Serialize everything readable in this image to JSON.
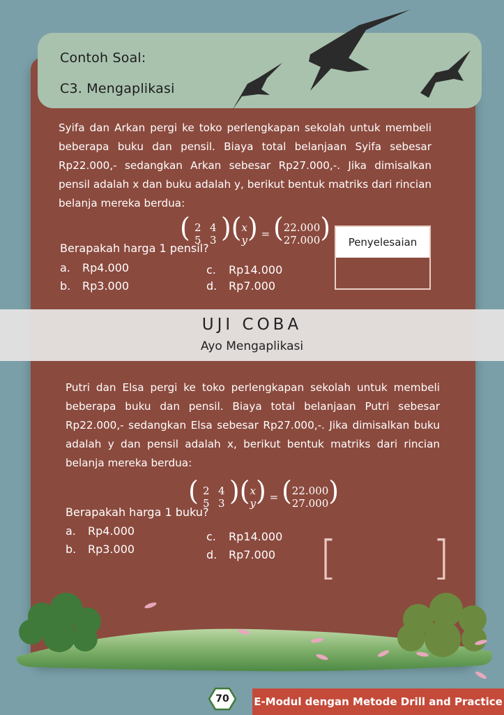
{
  "header": {
    "label": "Contoh Soal:",
    "section": "C3. Mengaplikasi"
  },
  "example": {
    "paragraph": "Syifa dan Arkan pergi ke toko perlengkapan sekolah untuk membeli beberapa buku dan pensil. Biaya total belanjaan Syifa sebesar Rp22.000,- sedangkan Arkan sebesar Rp27.000,-. Jika dimisalkan pensil adalah x dan buku adalah y, berikut bentuk matriks dari rincian belanja mereka berdua:",
    "matrix": {
      "a": "2",
      "b": "4",
      "c": "5",
      "d": "3",
      "v1": "x",
      "v2": "y",
      "r1": "22.000",
      "r2": "27.000",
      "eq": "="
    },
    "question": "Berapakah harga 1 pensil?",
    "options": [
      {
        "letter": "a.",
        "text": "Rp4.000"
      },
      {
        "letter": "b.",
        "text": "Rp3.000"
      },
      {
        "letter": "c.",
        "text": "Rp14.000"
      },
      {
        "letter": "d.",
        "text": "Rp7.000"
      }
    ],
    "answer_title": "Penyelesaian"
  },
  "trial": {
    "title": "UJI COBA",
    "subtitle": "Ayo Mengaplikasi",
    "paragraph": "Putri dan Elsa pergi ke toko perlengkapan sekolah untuk membeli beberapa buku dan pensil. Biaya total belanjaan Putri sebesar Rp22.000,- sedangkan Elsa sebesar Rp27.000,-. Jika dimisalkan buku adalah y dan pensil adalah x, berikut bentuk matriks dari rincian belanja mereka berdua:",
    "matrix": {
      "a": "2",
      "b": "4",
      "c": "5",
      "d": "3",
      "v1": "x",
      "v2": "y",
      "r1": "22.000",
      "r2": "27.000",
      "eq": "="
    },
    "question": "Berapakah harga 1 buku?",
    "options": [
      {
        "letter": "a.",
        "text": "Rp4.000"
      },
      {
        "letter": "b.",
        "text": "Rp3.000"
      },
      {
        "letter": "c.",
        "text": "Rp14.000"
      },
      {
        "letter": "d.",
        "text": "Rp7.000"
      }
    ],
    "bracket_left": "[",
    "bracket_right": "]"
  },
  "footer": {
    "page": "70",
    "title": "E-Modul dengan Metode Drill and Practice"
  },
  "colors": {
    "background": "#7a9fa8",
    "panel": "#8b4a3e",
    "header": "#a9c2ae",
    "footer_bar": "#c44a3a"
  },
  "icons": [
    "bird-icon",
    "bush-icon",
    "grass-icon",
    "petal-icon"
  ]
}
